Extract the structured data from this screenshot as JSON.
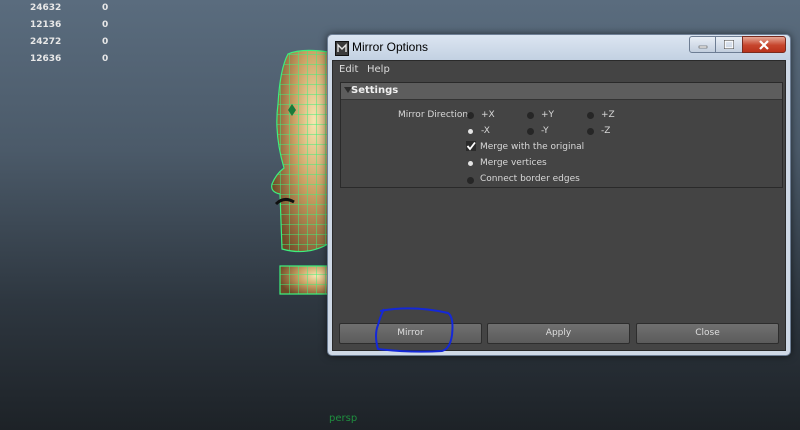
{
  "hud": {
    "rows": [
      {
        "a": "24632",
        "b": "0"
      },
      {
        "a": "12136",
        "b": "0"
      },
      {
        "a": "24272",
        "b": "0"
      },
      {
        "a": "12636",
        "b": "0"
      }
    ]
  },
  "viewport": {
    "camera_label": "persp"
  },
  "dialog": {
    "title": "Mirror Options",
    "menu": [
      "Edit",
      "Help"
    ],
    "settings_title": "Settings",
    "mirror_direction_label": "Mirror Direction:",
    "directions": [
      {
        "label": "+X",
        "selected": false
      },
      {
        "label": "+Y",
        "selected": false
      },
      {
        "label": "+Z",
        "selected": false
      },
      {
        "label": "-X",
        "selected": true
      },
      {
        "label": "-Y",
        "selected": false
      },
      {
        "label": "-Z",
        "selected": false
      }
    ],
    "merge_with_original": {
      "label": "Merge with the original",
      "checked": true
    },
    "merge_options": [
      {
        "label": "Merge vertices",
        "selected": true
      },
      {
        "label": "Connect border edges",
        "selected": false
      }
    ],
    "buttons": {
      "mirror": "Mirror",
      "apply": "Apply",
      "close": "Close"
    }
  },
  "colors": {
    "wireframe": "#3df07c",
    "annotation": "#1428d8",
    "panel": "#444444"
  }
}
